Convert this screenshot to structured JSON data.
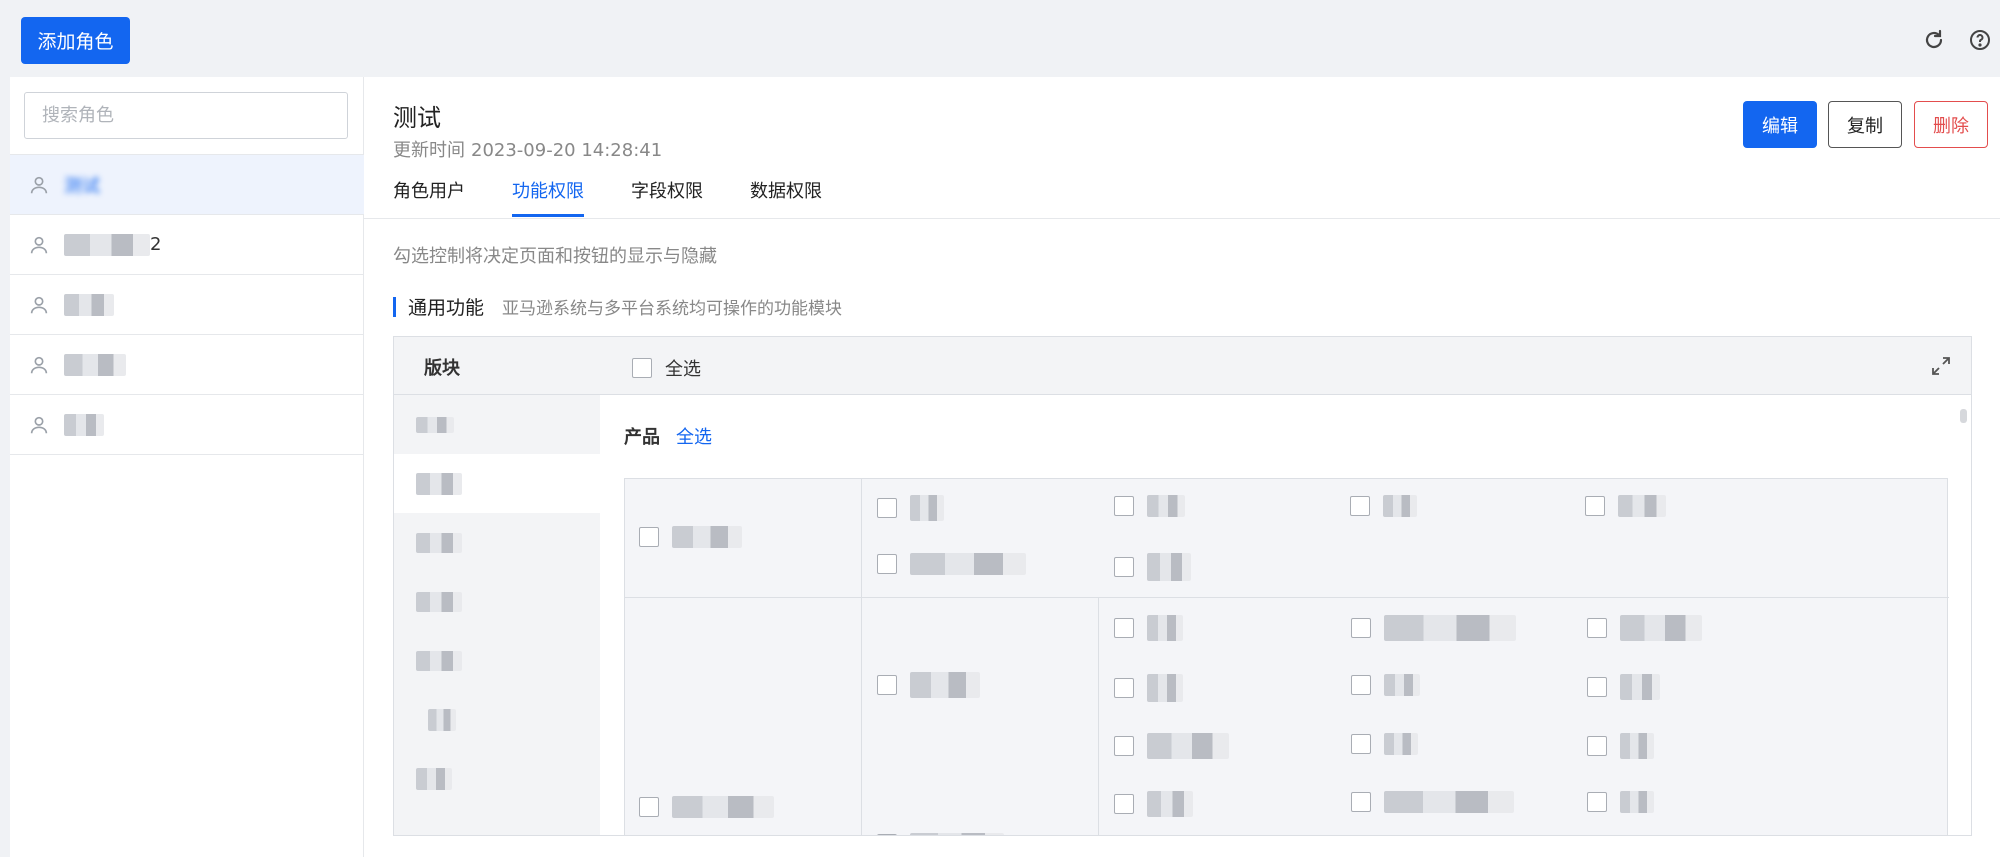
{
  "header": {
    "add_role_label": "添加角色",
    "refresh_icon": "refresh-icon",
    "help_icon": "help-icon"
  },
  "sidebar": {
    "search_placeholder": "搜索角色",
    "roles": [
      {
        "label": "测试",
        "active": true
      },
      {
        "label": "2",
        "active": false
      },
      {
        "label": "",
        "active": false
      },
      {
        "label": "",
        "active": false
      },
      {
        "label": "",
        "active": false
      }
    ]
  },
  "main": {
    "title": "测试",
    "updated_label": "更新时间",
    "updated_value": "2023-09-20 14:28:41",
    "actions": {
      "edit": "编辑",
      "copy": "复制",
      "delete": "删除"
    },
    "tabs": [
      {
        "label": "角色用户",
        "active": false
      },
      {
        "label": "功能权限",
        "active": true
      },
      {
        "label": "字段权限",
        "active": false
      },
      {
        "label": "数据权限",
        "active": false
      }
    ],
    "hint": "勾选控制将决定页面和按钮的显示与隐藏",
    "section": {
      "name": "通用功能",
      "desc": "亚马逊系统与多平台系统均可操作的功能模块"
    },
    "panel": {
      "block_label": "版块",
      "select_all": "全选",
      "category": {
        "name": "产品",
        "select_all": "全选"
      }
    }
  },
  "colors": {
    "accent": "#1366f0",
    "danger": "#e34d4d"
  }
}
